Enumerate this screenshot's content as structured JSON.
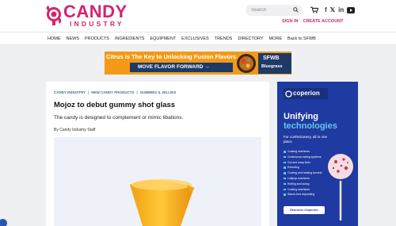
{
  "header": {
    "logo": {
      "name": "CANDY",
      "tagline": "INDUSTRY"
    },
    "search": {
      "placeholder": "Search"
    },
    "auth": {
      "sign_in": "SIGN IN",
      "create_account": "CREATE ACCOUNT"
    },
    "social": [
      "facebook-icon",
      "x-icon",
      "linkedin-icon",
      "youtube-icon"
    ],
    "brand_color": "#d1266f"
  },
  "nav": {
    "items": [
      "HOME",
      "NEWS",
      "PRODUCTS",
      "INGREDIENTS",
      "EQUIPMENT",
      "EXCLUSIVES",
      "TRENDS",
      "DIRECTORY",
      "MORE",
      "Back to SFWB"
    ]
  },
  "banner_ad": {
    "headline": "Citrus is The Key to Unlocking Fusion Flavors",
    "cta": "MOVE FLAVOR FORWARD →",
    "brand_top": "SFWB",
    "brand_bottom": "Bluegrass"
  },
  "article": {
    "breadcrumbs": [
      "CANDY INDUSTRY",
      "NEW CANDY PRODUCTS",
      "GUMMIES & JELLIES"
    ],
    "separator": "|",
    "title": "Mojoz to debut gummy shot glass",
    "subtitle": "The candy is designed to complement or mimic libations.",
    "byline": "By Candy Industry Staff"
  },
  "side_ad": {
    "brand": "coperion",
    "headline_1": "Unifying",
    "headline_2": "technologies",
    "description": "For confectionery, all in one place",
    "features": [
      "Coating machines",
      "Continuous mixing systems",
      "Cut and wrap lines",
      "Extruding",
      "Cooling and heating tunnels",
      "Lollipop machines",
      "Rolling and sizing",
      "Coating machines",
      "Starch-free depositing"
    ],
    "cta": "Discover Coperion"
  }
}
